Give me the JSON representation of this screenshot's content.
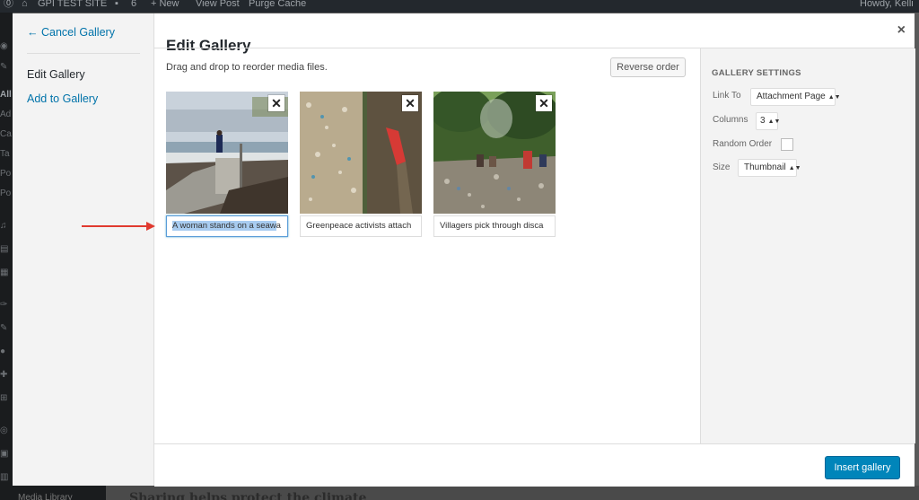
{
  "admin_bar": {
    "site_name": "GPI TEST SITE",
    "comments_count": "6",
    "new_label": "+ New",
    "view_post": "View Post",
    "purge_cache": "Purge Cache",
    "howdy": "Howdy, Kelli"
  },
  "admin_menu": [
    "All",
    "Ad",
    "Ca",
    "Ta",
    "Po",
    "Po"
  ],
  "background": {
    "heading": "Sharing helps protect the climate",
    "media_library": "Media Library"
  },
  "media_menu": {
    "cancel": "← Cancel Gallery",
    "items": [
      "Edit Gallery",
      "Add to Gallery"
    ]
  },
  "title": "Edit Gallery",
  "close_label": "×",
  "toolbar": {
    "instructions": "Drag and drop to reorder media files.",
    "reverse_label": "Reverse order"
  },
  "attachments": [
    {
      "caption_selected": "A woman stands on a seaw",
      "caption_rest": "a",
      "caption": "",
      "remove_label": "✕"
    },
    {
      "caption_selected": "",
      "caption_rest": "",
      "caption": "Greenpeace activists attach",
      "remove_label": "✕"
    },
    {
      "caption_selected": "",
      "caption_rest": "",
      "caption": "Villagers pick through disca",
      "remove_label": "✕"
    }
  ],
  "settings": {
    "heading": "GALLERY SETTINGS",
    "link_to_label": "Link To",
    "link_to_value": "Attachment Page",
    "columns_label": "Columns",
    "columns_value": "3",
    "random_label": "Random Order",
    "size_label": "Size",
    "size_value": "Thumbnail"
  },
  "footer": {
    "insert_label": "Insert gallery"
  },
  "colors": {
    "accent": "#0085ba",
    "link": "#0073aa",
    "arrow": "#e03a2f"
  }
}
